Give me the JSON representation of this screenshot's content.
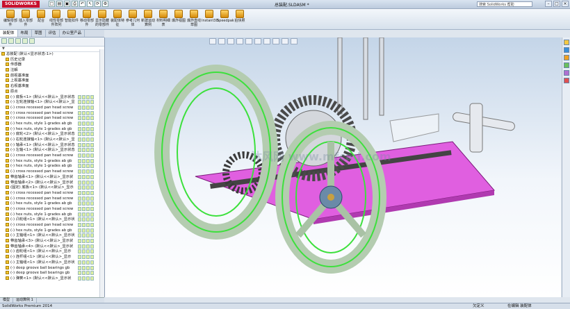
{
  "app": {
    "logo": "SOLIDWORKS",
    "doc_title": "总装配.SLDASM *",
    "search_placeholder": "搜索 SolidWorks 帮助"
  },
  "ribbon": [
    "编辑零部件",
    "插入零部件",
    "配合",
    "线性零部件阵列",
    "智能扣件",
    "移动零部件",
    "显示隐藏的零部件",
    "装配体特征",
    "参考几何体",
    "新建运动算例",
    "材料明细表",
    "爆炸视图",
    "爆炸直线草图",
    "Instant3D",
    "Speedpak",
    "拍快照"
  ],
  "panel_tabs": [
    "装配体",
    "布局",
    "草图",
    "评估",
    "办公室产品"
  ],
  "tree": {
    "root": "总装配 (默认<显示状态-1>)",
    "folders": [
      "历史记录",
      "传感器",
      "注解",
      "前视基准面",
      "上视基准面",
      "右视基准面",
      "原点"
    ],
    "items": [
      "(-) 底板<1> (默认<<默认>_显示状态",
      "(-) 左轮连接轴<1> (默认<<默认>_显",
      "(-) cross recessed pan head screw",
      "(-) cross recessed pan head screw",
      "(-) cross recessed pan head screw",
      "(-) hex nuts, style 1-grades ab gb",
      "(-) hex nuts, style 1-grades ab gb",
      "(-) 底轮<2> (默认<<默认>_显示状态",
      "(-) 右轮连接轴<1> (默认<<默认>_显",
      "(-) 轴承<1> (默认<<默认>_显示状态",
      "(-) 左轴<1> (默认<<默认>_显示状态",
      "(-) cross recessed pan head screw",
      "(-) hex nuts, style 1-grades ab gb",
      "(-) hex nuts, style 1-grades ab gb",
      "(-) cross recessed pan head screw",
      "带齿轴承<1> (默认<<默认>_显示状",
      "带齿轴承<2> (默认<<默认>_显示状",
      "(固定) 底板<1> (默认<<默认>_显示",
      "(-) cross recessed pan head screw",
      "(-) cross recessed pan head screw",
      "(-) hex nuts, style 1-grades ab gb",
      "(-) cross recessed pan head screw",
      "(-) hex nuts, style 1-grades ab gb",
      "(-) 凸轮组<1> (默认<<默认>_显示状",
      "(-) cross recessed pan head screw",
      "(-) hex nuts, style 1-grades ab gb",
      "(-) 主轴组<1> (默认<<默认>_显示状",
      "带齿轴承<3> (默认<<默认>_显示状",
      "带齿轴承<4> (默认<<默认>_显示状",
      "(-) 齿轮组<1> (默认<<默认>_显示",
      "(-) 连杆组<1> (默认<<默认>_显示",
      "(-) 主轴组<1> (默认<<默认>_显示状",
      "(-) deep groove ball bearings gb",
      "(-) deep groove ball bearings gb",
      "(-) 弹簧<1> (默认<<默认>_显示状"
    ]
  },
  "bottom_tabs": [
    "模型",
    "运动算例 1"
  ],
  "status": {
    "app": "SolidWorks Premium 2014",
    "state": "欠定义",
    "mode": "在编辑 装配体",
    "watermark": "沐风网 www.mfcad.com"
  }
}
